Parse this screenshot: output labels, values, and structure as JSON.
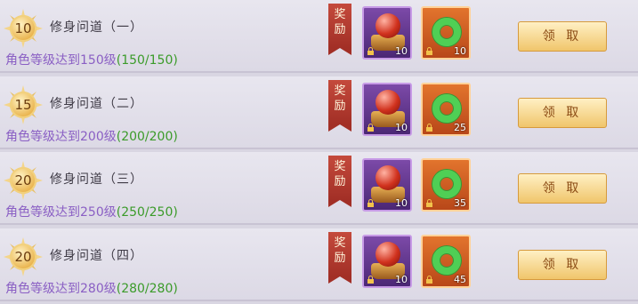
{
  "ribbon_label": [
    "奖",
    "励"
  ],
  "claim_label": "领 取",
  "rows": [
    {
      "level": "10",
      "title": "修身问道（一）",
      "condition": "角色等级达到150级",
      "progress": "(150/150)",
      "items": [
        {
          "name": "red-orb",
          "qty": "10"
        },
        {
          "name": "jade-ring",
          "qty": "10"
        }
      ]
    },
    {
      "level": "15",
      "title": "修身问道（二）",
      "condition": "角色等级达到200级",
      "progress": "(200/200)",
      "items": [
        {
          "name": "red-orb",
          "qty": "10"
        },
        {
          "name": "jade-ring",
          "qty": "25"
        }
      ]
    },
    {
      "level": "20",
      "title": "修身问道（三）",
      "condition": "角色等级达到250级",
      "progress": "(250/250)",
      "items": [
        {
          "name": "red-orb",
          "qty": "10"
        },
        {
          "name": "jade-ring",
          "qty": "35"
        }
      ]
    },
    {
      "level": "20",
      "title": "修身问道（四）",
      "condition": "角色等级达到280级",
      "progress": "(280/280)",
      "items": [
        {
          "name": "red-orb",
          "qty": "10"
        },
        {
          "name": "jade-ring",
          "qty": "45"
        }
      ]
    }
  ]
}
